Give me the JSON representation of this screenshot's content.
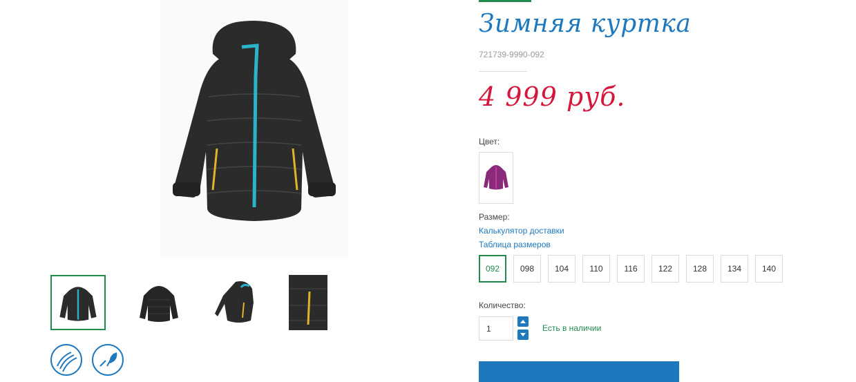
{
  "product": {
    "title": "Зимняя куртка",
    "sku": "721739-9990-092",
    "price": "4 999 руб."
  },
  "labels": {
    "color": "Цвет:",
    "size": "Размер:",
    "quantity": "Количество:"
  },
  "links": {
    "delivery_calculator": "Калькулятор доставки",
    "size_table": "Таблица размеров"
  },
  "sizes": [
    "092",
    "098",
    "104",
    "110",
    "116",
    "122",
    "128",
    "134",
    "140"
  ],
  "selected_size": "092",
  "quantity_value": "1",
  "stock_status": "Есть в наличии",
  "colors": {
    "brand_blue": "#1e78be",
    "brand_green": "#1f8a4c",
    "price_red": "#d4173b",
    "jacket": "#2b2b2b",
    "zip": "#2ab3c9",
    "swatch_color": "#8b2a7a"
  },
  "icons": {
    "feature_1": "breathable-fabric-icon",
    "feature_2": "eco-leaf-icon",
    "qty_up": "arrow-up-icon",
    "qty_down": "arrow-down-icon"
  }
}
